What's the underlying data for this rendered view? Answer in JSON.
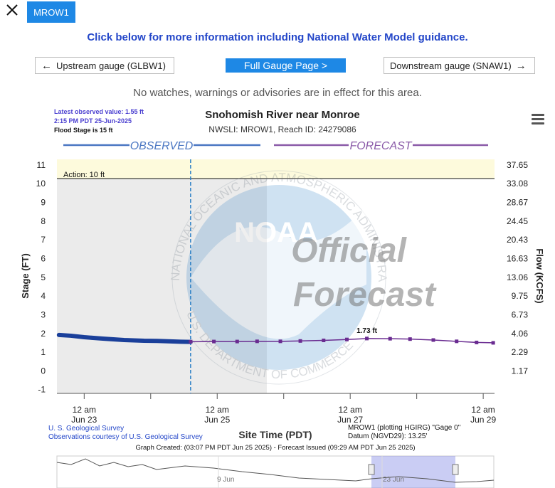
{
  "header": {
    "close_icon": "close-icon",
    "tab_label": "MROW1",
    "info_text": "Click below for more information including National Water Model guidance.",
    "upstream_label": "Upstream gauge (GLBW1)",
    "full_page_label": "Full Gauge Page >",
    "downstream_label": "Downstream gauge (SNAW1)",
    "advisory_text": "No watches, warnings or advisories are in effect for this area.",
    "menu_icon": "hamburger-menu-icon"
  },
  "colors": {
    "accent": "#1e88e5",
    "link_blue": "#2447c9",
    "observed": "#1a3f9a",
    "forecast": "#6a2c91",
    "action_band": "#fdfadc"
  },
  "chart": {
    "latest_line1": "Latest observed value: 1.55 ft",
    "latest_line2": "2:15 PM PDT 25-Jun-2025",
    "flood_stage": "Flood Stage is 15 ft",
    "title": "Snohomish River near Monroe",
    "subtitle": "NWSLI: MROW1, Reach ID: 24279086",
    "observed_label": "OBSERVED",
    "forecast_label": "FORECAST",
    "action_label": "Action: 10 ft",
    "peak_label": "1.73 ft",
    "ylabel_left": "Stage (FT)",
    "ylabel_right": "Flow (KCFS)",
    "xlabel": "Site Time (PDT)",
    "usgs_line1": "U. S. Geological Survey",
    "usgs_line2": "Observations courtesy of U.S. Geological Survey",
    "plotting_line1": "MROW1 (plotting HGIRG) \"Gage 0\"",
    "plotting_line2": "Datum (NGVD29): 13.25'",
    "created_line": "Graph Created: (03:07 PM PDT Jun 25 2025) - Forecast Issued (09:29 AM PDT Jun 25 2025)",
    "watermark_noaa": "NOAA",
    "watermark_official": "Official",
    "watermark_forecast": "Forecast",
    "seal_top": "NATIONAL OCEANIC AND ATMOSPHERIC ADMINISTRATION",
    "seal_bottom": "U.S. DEPARTMENT OF COMMERCE",
    "nav_ticks": [
      "9 Jun",
      "23 Jun"
    ]
  },
  "chart_data": {
    "type": "line",
    "y_left_ticks": [
      "11",
      "10",
      "9",
      "8",
      "7",
      "6",
      "5",
      "4",
      "3",
      "2",
      "1",
      "0",
      "-1"
    ],
    "y_right_ticks": [
      "37.65",
      "33.08",
      "28.67",
      "24.45",
      "20.43",
      "16.63",
      "13.06",
      "9.75",
      "6.73",
      "4.06",
      "2.29",
      "1.17"
    ],
    "x_ticks": [
      {
        "line1": "12 am",
        "line2": "Jun 23",
        "day": 23
      },
      {
        "line1": "12 am",
        "line2": "Jun 25",
        "day": 25
      },
      {
        "line1": "12 am",
        "line2": "Jun 27",
        "day": 27
      },
      {
        "line1": "12 am",
        "line2": "Jun 29",
        "day": 29
      }
    ],
    "ylim": [
      -1.2,
      11.3
    ],
    "xlim_day": [
      22.59,
      29.17
    ],
    "action_stage_ft": 10,
    "now_day": 24.6,
    "series": [
      {
        "name": "Observed",
        "x_day": [
          22.62,
          22.8,
          23.0,
          23.3,
          23.6,
          23.9,
          24.1,
          24.3,
          24.45,
          24.6
        ],
        "y_ft": [
          1.92,
          1.88,
          1.8,
          1.72,
          1.65,
          1.61,
          1.6,
          1.58,
          1.56,
          1.55
        ]
      },
      {
        "name": "Forecast",
        "x_day": [
          24.6,
          24.95,
          25.3,
          25.6,
          25.95,
          26.25,
          26.6,
          26.95,
          27.25,
          27.6,
          27.9,
          28.25,
          28.6,
          28.9,
          29.15
        ],
        "y_ft": [
          1.56,
          1.57,
          1.57,
          1.58,
          1.58,
          1.6,
          1.63,
          1.68,
          1.73,
          1.72,
          1.7,
          1.65,
          1.58,
          1.52,
          1.5
        ]
      }
    ],
    "peak": {
      "x_day": 27.25,
      "y_ft": 1.73
    }
  }
}
